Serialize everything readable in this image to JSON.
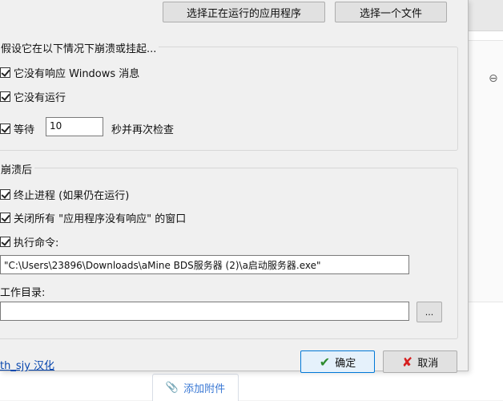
{
  "top_buttons": {
    "select_running_app": "选择正在运行的应用程序",
    "select_file": "选择一个文件"
  },
  "hang_group": {
    "title": "假设它在以下情况下崩溃或挂起...",
    "not_responding": "它没有响应 Windows 消息",
    "not_running": "它没有运行",
    "wait_label": "等待",
    "wait_value": "10",
    "recheck_label": "秒并再次检查"
  },
  "after_crash_group": {
    "title": "崩溃后",
    "terminate": "终止进程 (如果仍在运行)",
    "close_windows": "关闭所有 \"应用程序没有响应\" 的窗口",
    "exec_cmd": "执行命令:",
    "cmd_value": "\"C:\\Users\\23896\\Downloads\\aMine BDS服务器 (2)\\a启动服务器.exe\"",
    "workdir_label": "工作目录:",
    "workdir_value": "",
    "browse": "..."
  },
  "footer": {
    "credit_link": "th_sjy 汉化",
    "ok": "确定",
    "cancel": "取消"
  },
  "background": {
    "attach": "添加附件"
  },
  "icons": {
    "ok_icon": "check-icon",
    "cancel_icon": "x-icon",
    "attach_icon": "paperclip-icon",
    "link_icon": "link-icon"
  }
}
